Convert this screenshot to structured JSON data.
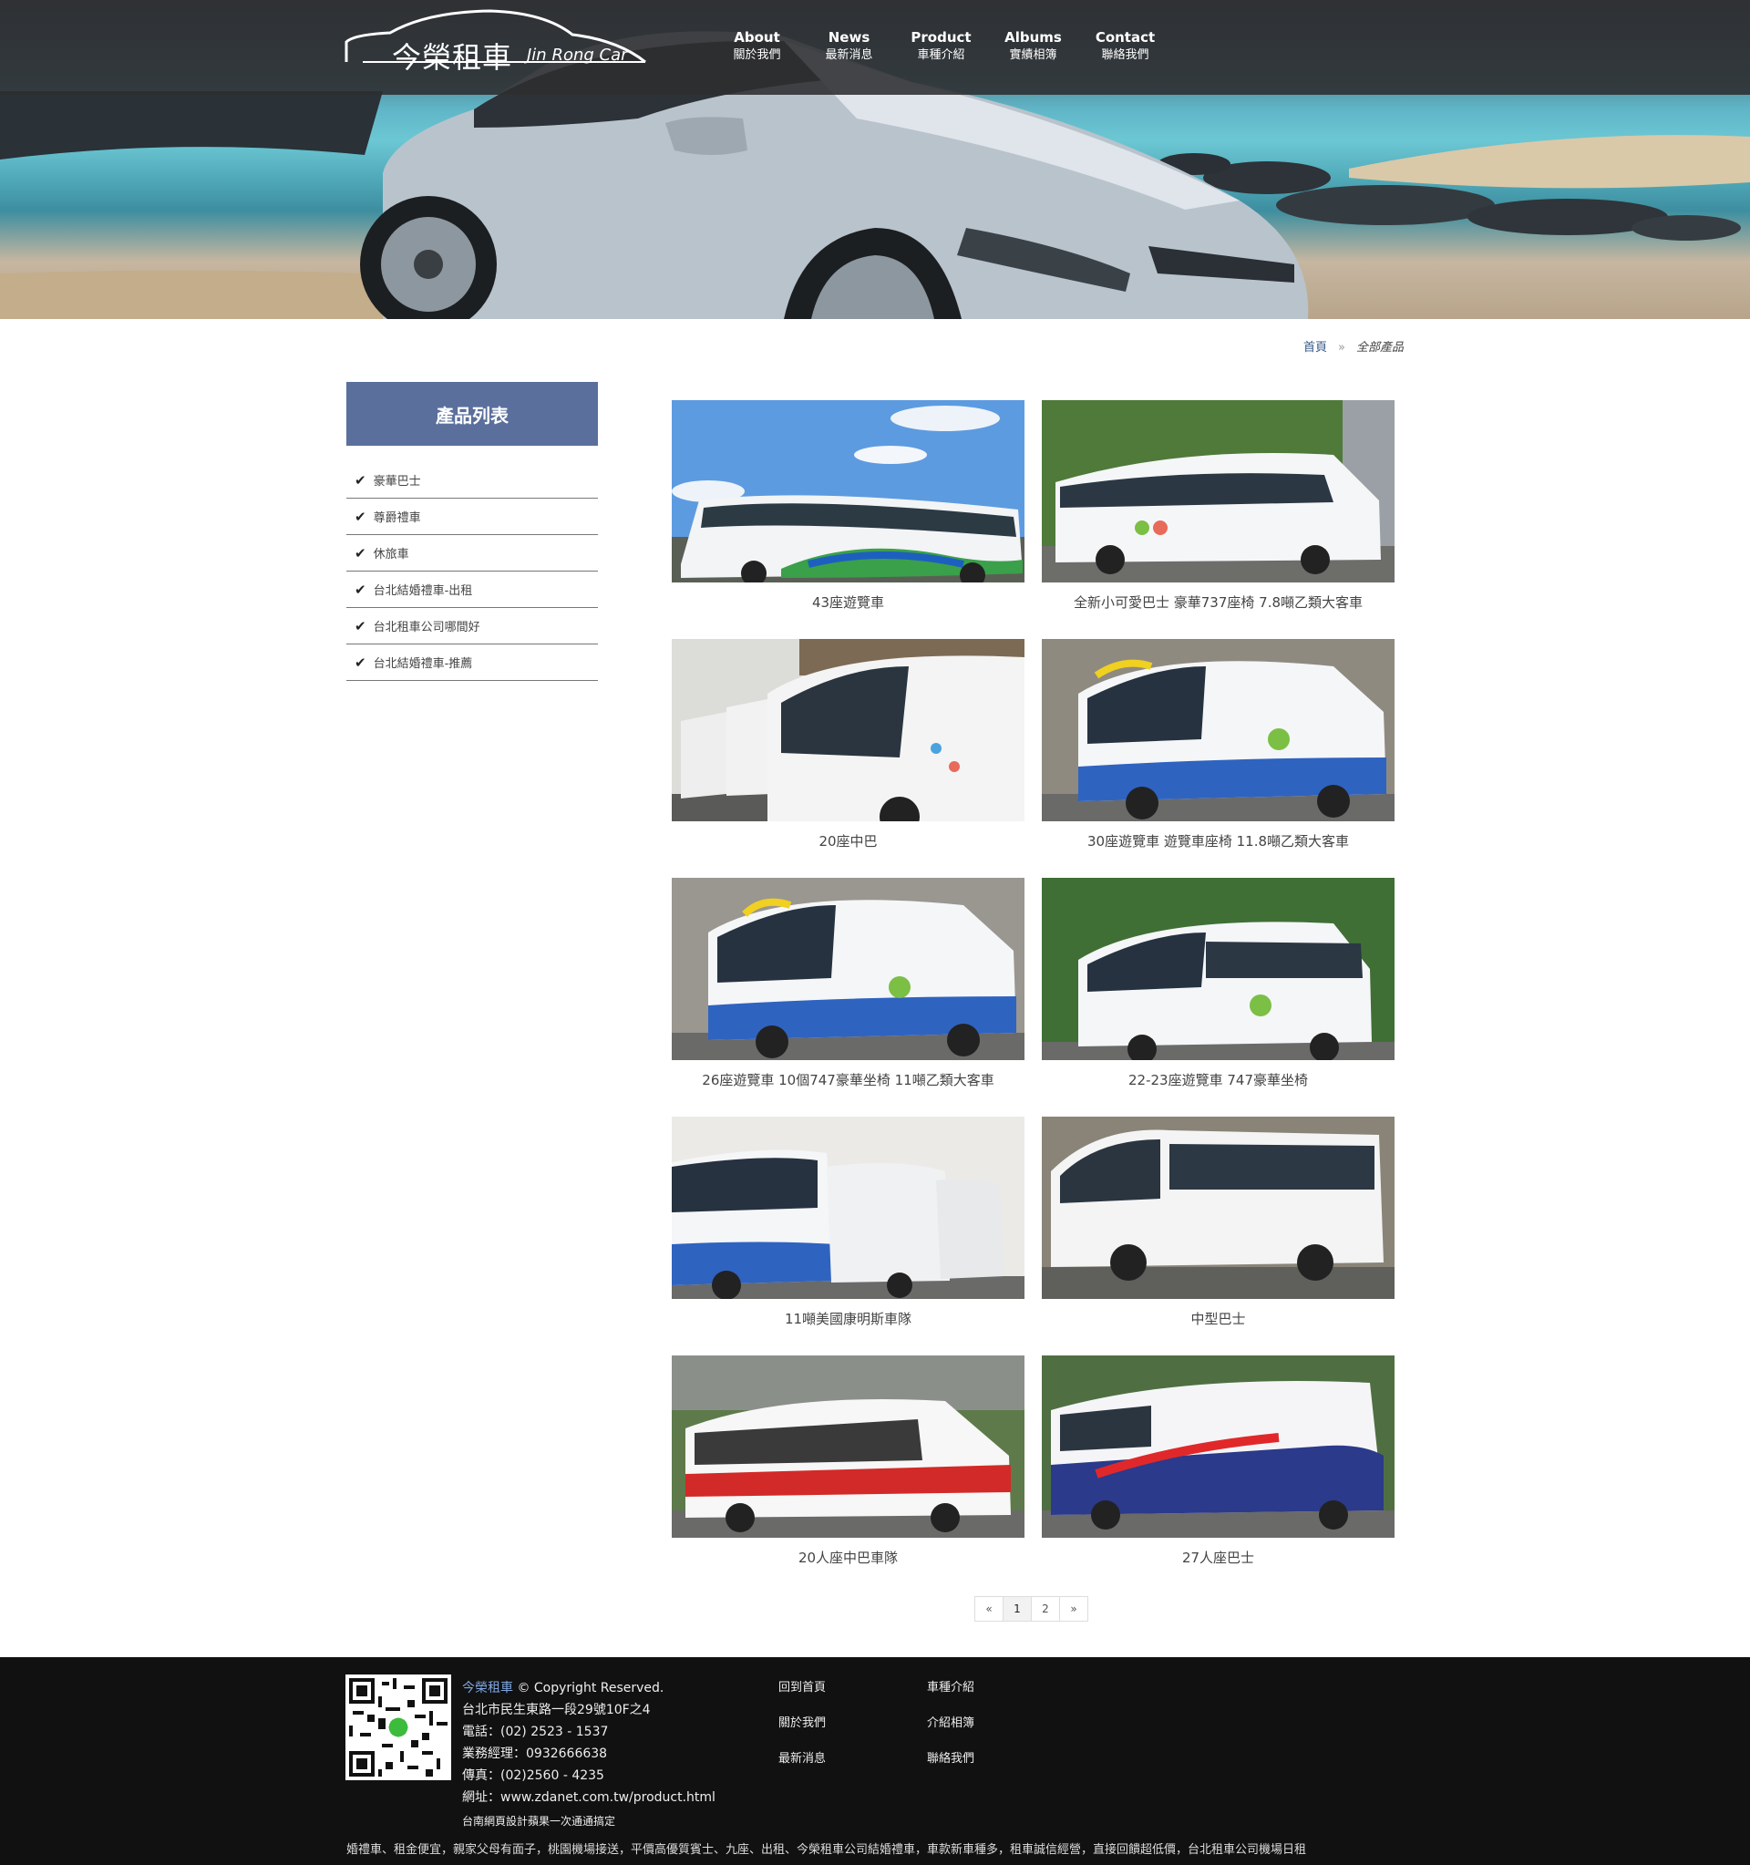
{
  "brand": {
    "name_cn": "今榮租車",
    "name_en": "Jin Rong Car"
  },
  "nav": [
    {
      "en": "About",
      "cn": "關於我們"
    },
    {
      "en": "News",
      "cn": "最新消息"
    },
    {
      "en": "Product",
      "cn": "車種介紹"
    },
    {
      "en": "Albums",
      "cn": "實績相簿"
    },
    {
      "en": "Contact",
      "cn": "聯絡我們"
    }
  ],
  "breadcrumb": {
    "home": "首頁",
    "sep": "»",
    "current": "全部產品"
  },
  "sidebar": {
    "title": "產品列表",
    "items": [
      "豪華巴士",
      "尊爵禮車",
      "休旅車",
      "台北結婚禮車-出租",
      "台北租車公司哪間好",
      "台北結婚禮車-推薦"
    ]
  },
  "products": [
    {
      "caption": "43座遊覽車"
    },
    {
      "caption": "全新小可愛巴士 豪華737座椅 7.8噸乙類大客車"
    },
    {
      "caption": "20座中巴"
    },
    {
      "caption": "30座遊覽車 遊覽車座椅 11.8噸乙類大客車"
    },
    {
      "caption": "26座遊覽車 10個747豪華坐椅 11噸乙類大客車"
    },
    {
      "caption": "22-23座遊覽車 747豪華坐椅"
    },
    {
      "caption": "11噸美國康明斯車隊"
    },
    {
      "caption": "中型巴士"
    },
    {
      "caption": "20人座中巴車隊"
    },
    {
      "caption": "27人座巴士"
    }
  ],
  "pager": {
    "prev": "«",
    "pages": [
      "1",
      "2"
    ],
    "next": "»"
  },
  "footer": {
    "brand": "今榮租車",
    "copyright": "© Copyright Reserved.",
    "address": "台北市民生東路一段29號10F之4",
    "phone": "電話：(02) 2523 - 1537",
    "manager": "業務經理：0932666638",
    "fax": "傳真：(02)2560 - 4235",
    "site": "網址：www.zdanet.com.tw/product.html",
    "credit": "台南網頁設計蘋果一次通通搞定",
    "links_col1": [
      "回到首頁",
      "關於我們",
      "最新消息"
    ],
    "links_col2": [
      "車種介紹",
      "介紹相簿",
      "聯絡我們"
    ],
    "ticker": "婚禮車、租金便宜，親家父母有面子，桃園機場接送，平價高優質賓士、九座、出租、今榮租車公司結婚禮車，車款新車種多，租車誠信經營，直接回饋超低價，台北租車公司機場日租"
  }
}
